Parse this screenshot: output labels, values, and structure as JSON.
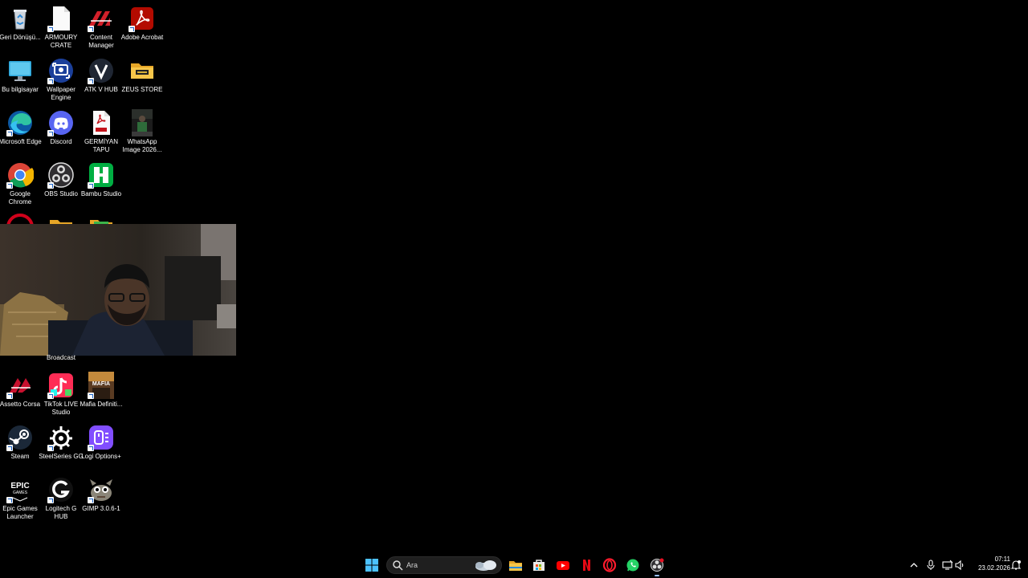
{
  "desktop": {
    "icons": [
      {
        "label": "Geri Dönüşü...",
        "icon": "recycle-bin-icon"
      },
      {
        "label": "ARMOURY CRATE",
        "icon": "file-icon"
      },
      {
        "label": "Content Manager",
        "icon": "content-manager-icon"
      },
      {
        "label": "Adobe Acrobat",
        "icon": "adobe-acrobat-icon"
      },
      {
        "label": "Bu bilgisayar",
        "icon": "this-pc-icon"
      },
      {
        "label": "Wallpaper Engine",
        "icon": "wallpaper-engine-icon"
      },
      {
        "label": "ATK V HUB",
        "icon": "atk-v-hub-icon"
      },
      {
        "label": "ZEUS STORE",
        "icon": "folder-icon"
      },
      {
        "label": "Microsoft Edge",
        "icon": "edge-icon"
      },
      {
        "label": "Discord",
        "icon": "discord-icon"
      },
      {
        "label": "GERMİYAN TAPU",
        "icon": "pdf-icon"
      },
      {
        "label": "WhatsApp Image 2026...",
        "icon": "image-thumbnail-icon"
      },
      {
        "label": "Google Chrome",
        "icon": "chrome-icon"
      },
      {
        "label": "OBS Studio",
        "icon": "obs-icon"
      },
      {
        "label": "Bambu Studio",
        "icon": "bambu-studio-icon"
      },
      {
        "label": "Broadcast",
        "icon": ""
      },
      {
        "label": "Assetto Corsa",
        "icon": "assetto-corsa-icon"
      },
      {
        "label": "TikTok LIVE Studio",
        "icon": "tiktok-icon"
      },
      {
        "label": "Mafia Definiti...",
        "icon": "mafia-icon"
      },
      {
        "label": "Steam",
        "icon": "steam-icon"
      },
      {
        "label": "SteelSeries GG",
        "icon": "steelseries-icon"
      },
      {
        "label": "Logi Options+",
        "icon": "logi-options-icon"
      },
      {
        "label": "Epic Games Launcher",
        "icon": "epic-games-icon"
      },
      {
        "label": "Logitech G HUB",
        "icon": "logitech-g-icon"
      },
      {
        "label": "GIMP 3.0.6-1",
        "icon": "gimp-icon"
      }
    ]
  },
  "taskbar": {
    "search_placeholder": "Ara",
    "apps": [
      "start-icon",
      "file-explorer-icon",
      "microsoft-store-icon",
      "youtube-icon",
      "netflix-icon",
      "opera-icon",
      "whatsapp-icon",
      "obs-icon"
    ],
    "clock": {
      "time": "07:11",
      "date": "23.02.2026"
    }
  },
  "colors": {
    "background": "#000000",
    "taskbar": "#000000",
    "accent": "#0078d4"
  }
}
